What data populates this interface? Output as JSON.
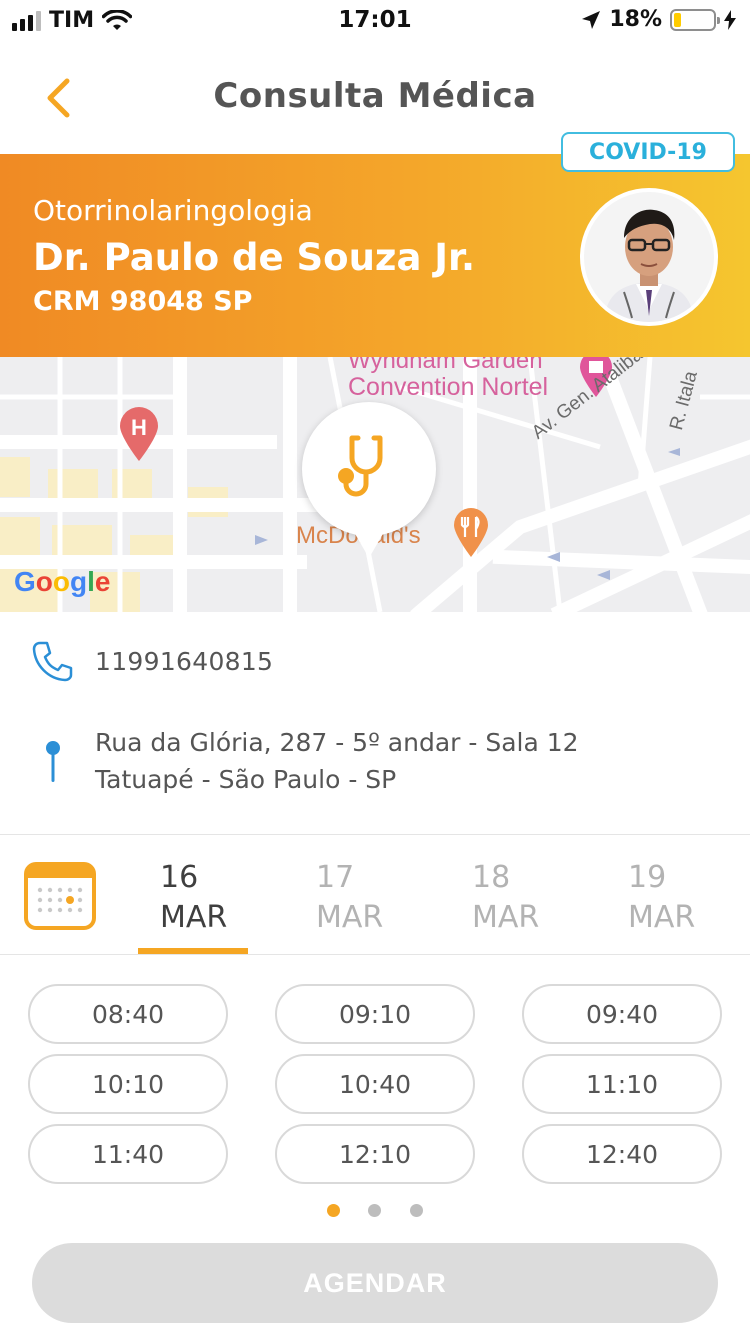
{
  "status_bar": {
    "carrier": "TIM",
    "time": "17:01",
    "battery_percent": "18%",
    "battery_level": 0.18,
    "signal_bars_on": 3,
    "signal_bars_total": 4,
    "icons": [
      "signal-icon",
      "wifi-icon",
      "location-arrow-icon",
      "battery-icon",
      "charging-bolt-icon"
    ]
  },
  "nav": {
    "title": "Consulta Médica",
    "back_icon": "chevron-left-icon"
  },
  "doctor": {
    "badge": "COVID-19",
    "specialty": "Otorrinolaringologia",
    "name": "Dr. Paulo de Souza Jr.",
    "crm": "CRM 98048 SP"
  },
  "map": {
    "labels": {
      "convention": "Convention Nortel",
      "hotel": "Wyndham Garden",
      "restaurant": "McDonald's",
      "street1": "Av. Gen. Ataliba Leone",
      "street2": "R. Itala"
    },
    "google": {
      "g1": "G",
      "o1": "o",
      "o2": "o",
      "g2": "g",
      "l": "l",
      "e": "e"
    },
    "marker_icon": "stethoscope-icon"
  },
  "contact": {
    "phone": "11991640815",
    "address_line1": "Rua da Glória, 287 - 5º andar - Sala 12",
    "address_line2": "Tatuapé - São Paulo - SP"
  },
  "dates": [
    {
      "day": "16",
      "month": "MAR",
      "selected": true
    },
    {
      "day": "17",
      "month": "MAR",
      "selected": false
    },
    {
      "day": "18",
      "month": "MAR",
      "selected": false
    },
    {
      "day": "19",
      "month": "MAR",
      "selected": false
    }
  ],
  "time_slots": [
    "08:40",
    "09:10",
    "09:40",
    "10:10",
    "10:40",
    "11:10",
    "11:40",
    "12:10",
    "12:40"
  ],
  "pagination": {
    "pages": 3,
    "current": 1
  },
  "cta": {
    "label": "AGENDAR",
    "enabled": false
  },
  "colors": {
    "accent": "#f5a623",
    "banner_start": "#f08a24",
    "banner_end": "#f5c62f",
    "badge_blue": "#2ab0db",
    "disabled_button": "#dcdcdc"
  }
}
